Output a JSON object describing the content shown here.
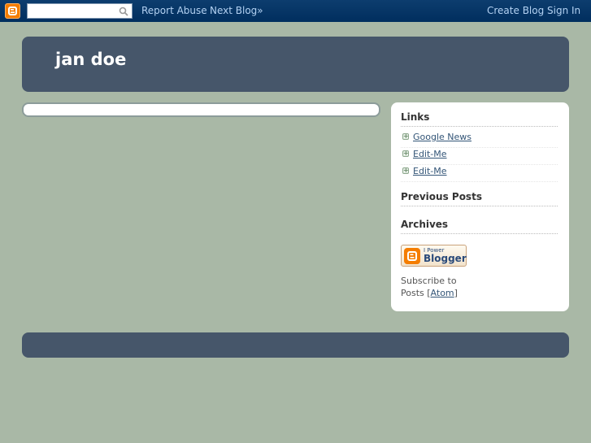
{
  "navbar": {
    "logo_icon": "blogger-icon",
    "search_value": "",
    "search_icon": "search-icon",
    "report_abuse": "Report Abuse",
    "next_blog": "Next Blog»",
    "create_blog": "Create Blog",
    "sign_in": "Sign In"
  },
  "header": {
    "title": "jan doe"
  },
  "sidebar": {
    "links_heading": "Links",
    "links": [
      {
        "label": "Google News"
      },
      {
        "label": "Edit-Me"
      },
      {
        "label": "Edit-Me"
      }
    ],
    "previous_posts_heading": "Previous Posts",
    "archives_heading": "Archives",
    "badge": {
      "small_text": "I Power",
      "big_text": "Blogger"
    },
    "subscribe": {
      "text": "Subscribe to",
      "posts": "Posts",
      "open_bracket": "[",
      "atom": "Atom",
      "close_bracket": "]"
    }
  },
  "colors": {
    "background": "#a9b8a6",
    "navbar": "#003366",
    "header": "#46566a",
    "accent": "#f57d00",
    "link": "#335577"
  }
}
